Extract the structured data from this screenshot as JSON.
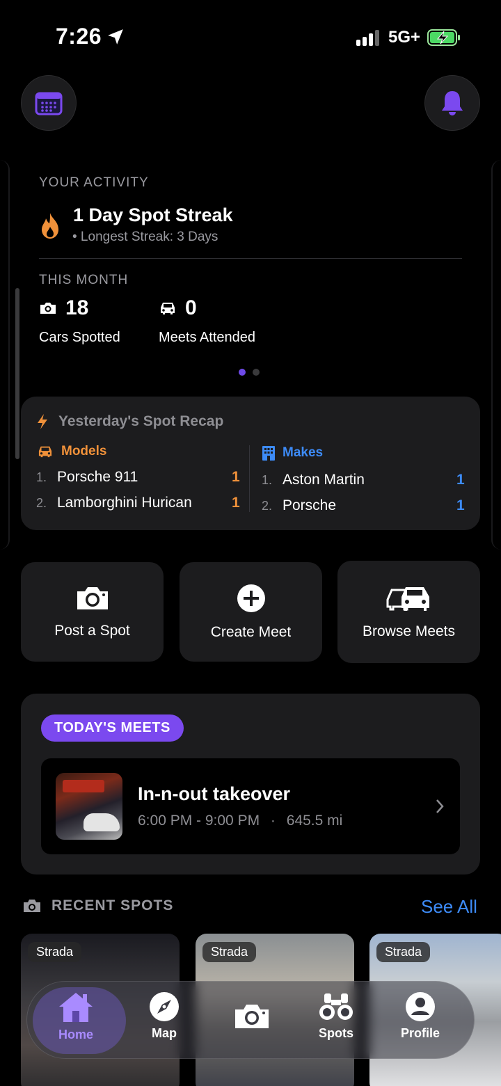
{
  "status_bar": {
    "time": "7:26",
    "network": "5G+"
  },
  "activity": {
    "section_label": "YOUR ACTIVITY",
    "streak_title": "1 Day Spot Streak",
    "streak_sub": "• Longest Streak: 3 Days",
    "month_label": "THIS MONTH",
    "cars_spotted": {
      "value": "18",
      "label": "Cars Spotted"
    },
    "meets_attended": {
      "value": "0",
      "label": "Meets Attended"
    },
    "page_dots": {
      "total": 2,
      "active": 1
    }
  },
  "recap": {
    "title": "Yesterday's Spot Recap",
    "models_label": "Models",
    "makes_label": "Makes",
    "models": [
      {
        "rank": "1.",
        "name": "Porsche 911",
        "count": "1"
      },
      {
        "rank": "2.",
        "name": "Lamborghini Hurican",
        "count": "1"
      }
    ],
    "makes": [
      {
        "rank": "1.",
        "name": "Aston Martin",
        "count": "1"
      },
      {
        "rank": "2.",
        "name": "Porsche",
        "count": "1"
      }
    ]
  },
  "actions": {
    "post_spot": "Post a Spot",
    "create_meet": "Create Meet",
    "browse_meets": "Browse Meets"
  },
  "todays_meets": {
    "label": "TODAY'S MEETS",
    "meet": {
      "title": "In-n-out takeover",
      "time": "6:00 PM - 9:00 PM",
      "separator": "·",
      "distance": "645.5 mi"
    }
  },
  "recent_spots": {
    "label": "RECENT SPOTS",
    "see_all": "See All",
    "items": [
      {
        "tag": "Strada"
      },
      {
        "tag": "Strada"
      },
      {
        "tag": "Strada"
      }
    ]
  },
  "tabbar": {
    "home": "Home",
    "map": "Map",
    "spots": "Spots",
    "profile": "Profile",
    "active": "home"
  },
  "colors": {
    "accent_purple": "#7b49ef",
    "orange": "#f0913a",
    "blue": "#3d8bf7",
    "card_bg": "#1c1c1e"
  }
}
